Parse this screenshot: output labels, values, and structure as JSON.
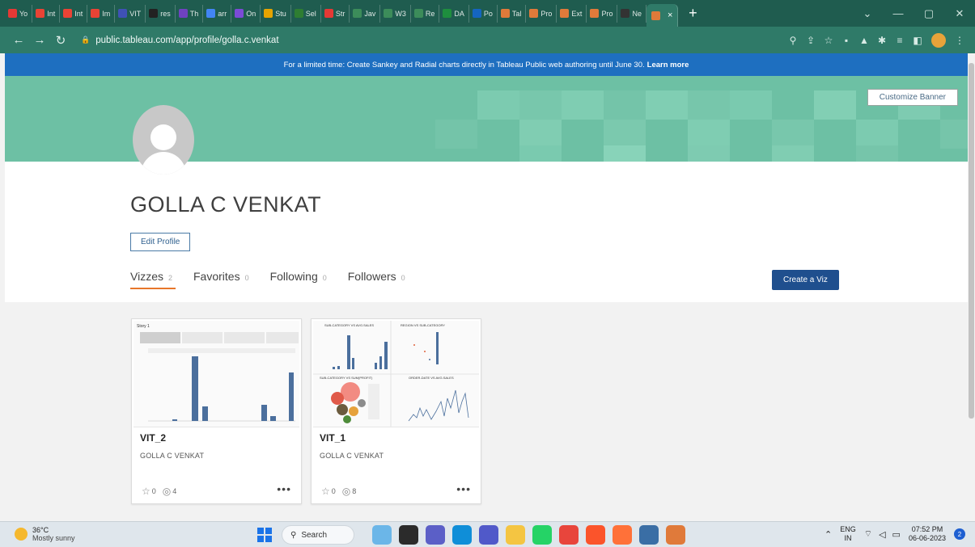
{
  "browser": {
    "tabs": [
      {
        "label": "Yo",
        "color": "#e53935"
      },
      {
        "label": "Int",
        "color": "#ea4335"
      },
      {
        "label": "Int",
        "color": "#ea4335"
      },
      {
        "label": "Im",
        "color": "#ea4335"
      },
      {
        "label": "VIT",
        "color": "#3f51b5"
      },
      {
        "label": "res",
        "color": "#222222"
      },
      {
        "label": "Th",
        "color": "#6f42c1"
      },
      {
        "label": "arr",
        "color": "#4285f4"
      },
      {
        "label": "On",
        "color": "#7b4bd6"
      },
      {
        "label": "Stu",
        "color": "#e6a400"
      },
      {
        "label": "Sel",
        "color": "#2e7d32"
      },
      {
        "label": "Str",
        "color": "#e53935"
      },
      {
        "label": "Jav",
        "color": "#3c8c5a"
      },
      {
        "label": "W3",
        "color": "#3c8c5a"
      },
      {
        "label": "Re",
        "color": "#3c8c5a"
      },
      {
        "label": "DA",
        "color": "#1e8e3e"
      },
      {
        "label": "Po",
        "color": "#1565c0"
      },
      {
        "label": "Tal",
        "color": "#e07a3a"
      },
      {
        "label": "Pro",
        "color": "#e07a3a"
      },
      {
        "label": "Ext",
        "color": "#e07a3a"
      },
      {
        "label": "Pro",
        "color": "#e07a3a"
      },
      {
        "label": "Ne",
        "color": "#333333"
      }
    ],
    "active_tab_close": "×",
    "new_tab": "+",
    "url": "public.tableau.com/app/profile/golla.c.venkat"
  },
  "promo": {
    "text": "For a limited time: Create Sankey and Radial charts directly in Tableau Public web authoring until June 30.",
    "link": "Learn more"
  },
  "banner": {
    "customize_label": "Customize Banner"
  },
  "profile": {
    "name": "GOLLA C VENKAT",
    "edit_label": "Edit Profile",
    "tabs": [
      {
        "label": "Vizzes",
        "count": "2"
      },
      {
        "label": "Favorites",
        "count": "0"
      },
      {
        "label": "Following",
        "count": "0"
      },
      {
        "label": "Followers",
        "count": "0"
      }
    ],
    "create_label": "Create a Viz"
  },
  "vizzes": [
    {
      "title": "VIT_2",
      "author": "GOLLA C VENKAT",
      "favorites": "0",
      "views": "4",
      "more": "•••"
    },
    {
      "title": "VIT_1",
      "author": "GOLLA C VENKAT",
      "favorites": "0",
      "views": "8",
      "more": "•••"
    }
  ],
  "thumb_text": {
    "story_title": "Story 1",
    "p1": "SUB-CATEGORY VS AVG.SALES",
    "p2": "REGION VS SUB-CATEGORY",
    "p3": "SUB-CATEGORY VS SUM(PROFIT)",
    "p4": "ORDER-DATE VS AVG.SALES"
  },
  "taskbar": {
    "temp": "36°C",
    "weather": "Mostly sunny",
    "search_label": "Search",
    "lang": "ENG",
    "region": "IN",
    "time": "07:52 PM",
    "date": "06-06-2023",
    "notifications": "2"
  },
  "colors": {
    "chrome_dark": "#1f5c4f",
    "chrome_light": "#2f7a68",
    "promo_blue": "#1e6fc0",
    "banner_green": "#6dc0a4",
    "create_button": "#1f4f8e",
    "tab_underline": "#e7762a"
  }
}
